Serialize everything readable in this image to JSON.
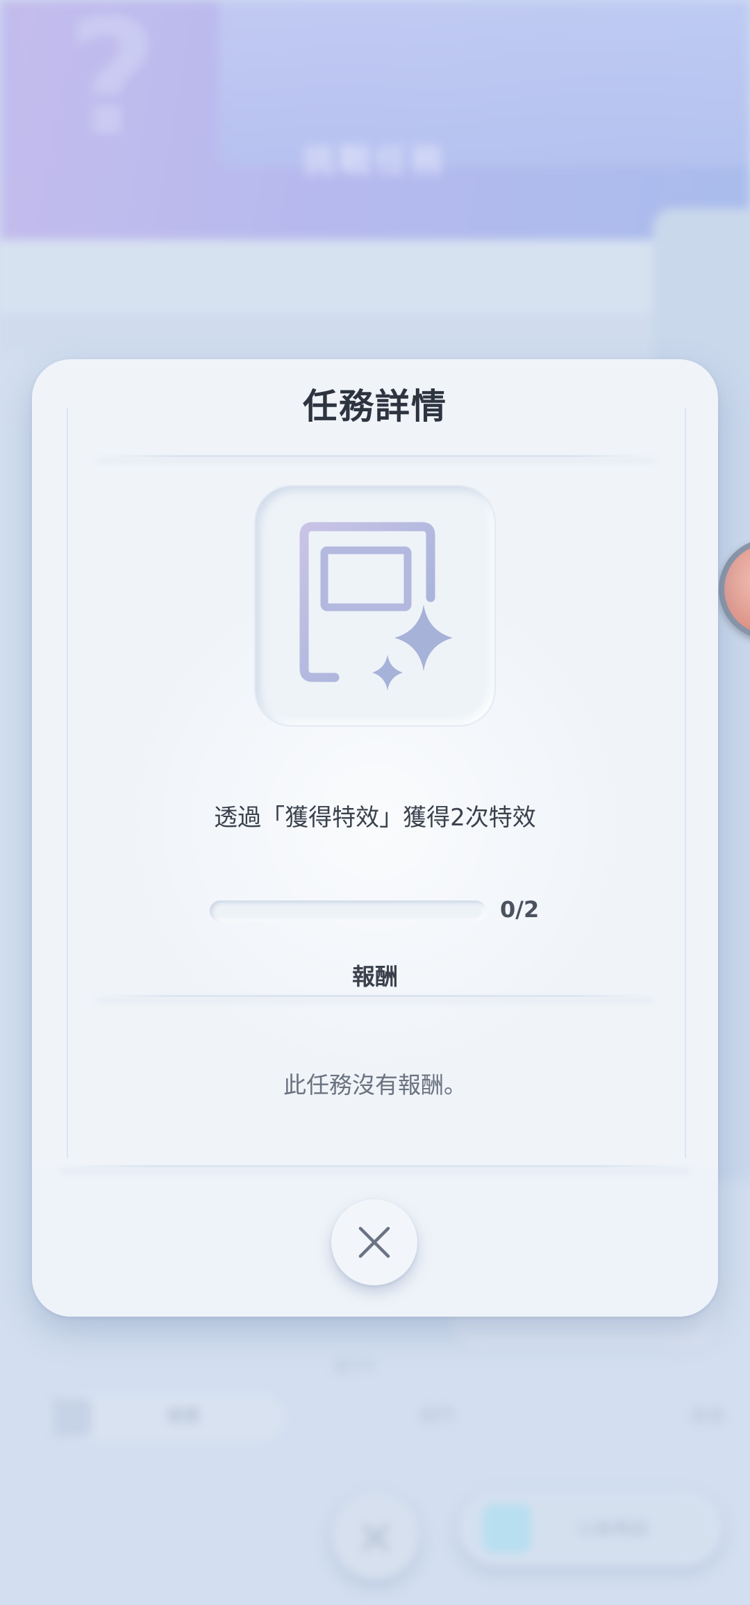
{
  "background": {
    "banner_title": "挑戰任務",
    "chip_label": "推薦",
    "row_label_1": "熱門",
    "row_label_2": "其他",
    "small_label": "進行中",
    "confirm_label": "以後再說"
  },
  "modal": {
    "title": "任務詳情",
    "task_icon": "photo-sparkle-icon",
    "task_description": "透過「獲得特效」獲得2次特效",
    "progress": {
      "current": 0,
      "total": 2,
      "text": "0/2"
    },
    "reward_label": "報酬",
    "reward_empty_text": "此任務沒有報酬。",
    "close_icon": "close-icon"
  },
  "colors": {
    "modal_bg": "#f0f4f9",
    "title_text": "#2d3440",
    "icon_stroke": "#a9b4d8",
    "page_bg": "#d3dff0"
  }
}
